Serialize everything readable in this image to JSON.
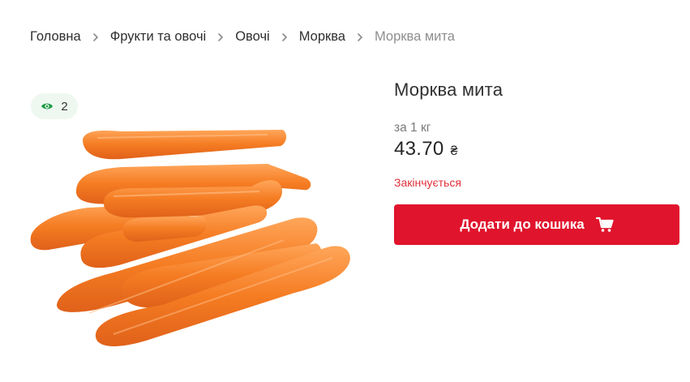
{
  "breadcrumb": {
    "items": [
      "Головна",
      "Фрукти та овочі",
      "Овочі",
      "Морква"
    ],
    "current": "Морква мита"
  },
  "views": {
    "count": "2",
    "icon": "eye-icon",
    "color": "#1f9a45"
  },
  "product": {
    "title": "Морква мита",
    "unit": "за 1 кг",
    "price": "43.70",
    "currency": "₴",
    "stock_status": "Закінчується",
    "add_to_cart_label": "Додати до кошика",
    "cart_icon": "cart-icon"
  },
  "colors": {
    "accent": "#e0142c",
    "stock_warning": "#e0303b",
    "carrot": "#f07a2a"
  }
}
